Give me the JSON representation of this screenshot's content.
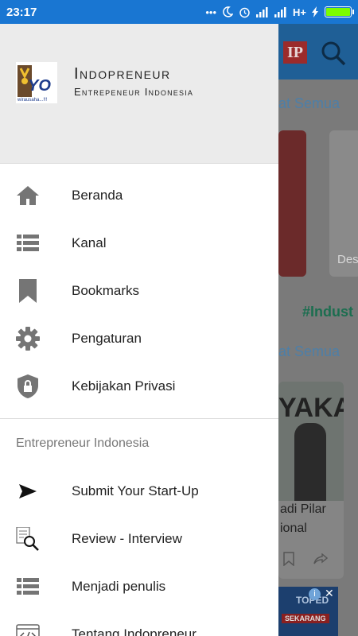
{
  "status_bar": {
    "time": "23:17",
    "network": "H+",
    "battery_level": 1.0,
    "icons": [
      "more-dots-icon",
      "moon-icon",
      "alarm-icon",
      "signal-icon",
      "signal-icon",
      "charging-icon",
      "battery-icon"
    ]
  },
  "drawer": {
    "brand": {
      "name": "Indopreneur",
      "subtitle": "Entrepeneur Indonesia"
    },
    "menu": [
      {
        "label": "Beranda",
        "icon": "home-icon"
      },
      {
        "label": "Kanal",
        "icon": "list-icon"
      },
      {
        "label": "Bookmarks",
        "icon": "bookmark-icon"
      },
      {
        "label": "Pengaturan",
        "icon": "gear-icon"
      },
      {
        "label": "Kebijakan Privasi",
        "icon": "shield-lock-icon"
      }
    ],
    "section_title": "Entrepreneur Indonesia",
    "section_items": [
      {
        "label": "Submit Your Start-Up",
        "icon": "send-icon"
      },
      {
        "label": "Review - Interview",
        "icon": "document-search-icon"
      },
      {
        "label": "Menjadi penulis",
        "icon": "list-icon"
      },
      {
        "label": "Tentang Indopreneur",
        "icon": "code-icon"
      }
    ]
  },
  "background": {
    "logo_text": "IP",
    "see_all_1": "at Semua",
    "see_all_2": "at Semua",
    "card_text": "Des",
    "hashtag": "#Indust",
    "article_text_1": "adi Pilar",
    "article_text_2": "ional",
    "banner_text": "YAKA",
    "ad_text_1": "TOPED",
    "ad_text_2": "SEKARANG"
  },
  "colors": {
    "status_bar": "#1976d2",
    "drawer_header": "#ebebeb",
    "icon": "#757575",
    "battery": "#7cfc00"
  }
}
